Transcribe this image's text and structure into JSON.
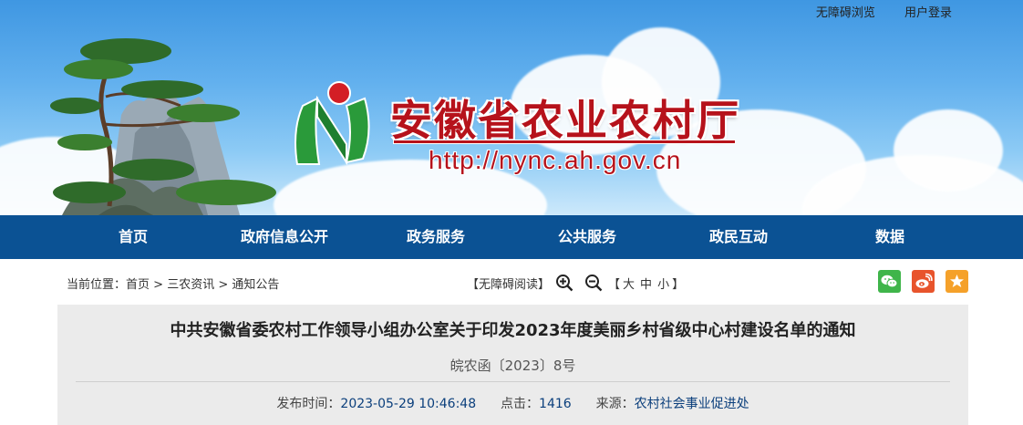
{
  "header": {
    "toplinks": {
      "accessible_browse": "无障碍浏览",
      "user_login": "用户登录"
    },
    "site_title": "安徽省农业农村厅",
    "site_url": "http://nync.ah.gov.cn",
    "brand_color": "#b6121b"
  },
  "nav": {
    "color": "#0b5294",
    "items": [
      {
        "label": "首页"
      },
      {
        "label": "政府信息公开"
      },
      {
        "label": "政务服务"
      },
      {
        "label": "公共服务"
      },
      {
        "label": "政民互动"
      },
      {
        "label": "数据"
      }
    ]
  },
  "breadcrumb": {
    "prefix": "当前位置：",
    "items": [
      "首页",
      "三农资讯",
      "通知公告"
    ],
    "separator": ">"
  },
  "reading_tools": {
    "accessible_read": "【无障碍阅读】",
    "zoom_in_icon": "zoom-in-icon",
    "zoom_out_icon": "zoom-out-icon",
    "size_open": "【",
    "size_large": "大",
    "size_medium": "中",
    "size_small": "小",
    "size_close": "】"
  },
  "share": {
    "wechat_color": "#3fb54a",
    "weibo_color": "#e8542c",
    "favorite_color": "#f5a12a"
  },
  "article": {
    "title": "中共安徽省委农村工作领导小组办公室关于印发2023年度美丽乡村省级中心村建设名单的通知",
    "doc_no": "皖农函〔2023〕8号",
    "publish_label": "发布时间：",
    "publish_time": "2023-05-29 10:46:48",
    "clicks_label": "点击：",
    "clicks": "1416",
    "source_label": "来源：",
    "source": "农村社会事业促进处"
  }
}
